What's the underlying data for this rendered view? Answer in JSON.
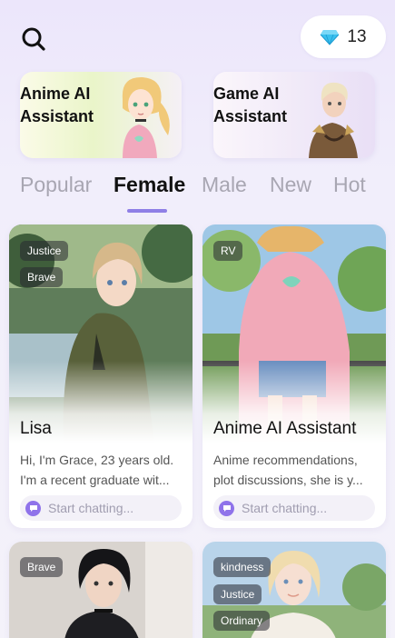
{
  "header": {
    "search_icon": "search-icon",
    "gem_icon": "diamond-icon",
    "gem_count": "13"
  },
  "promos": [
    {
      "title": "Anime AI Assistant"
    },
    {
      "title": "Game AI Assistant"
    }
  ],
  "tabs": [
    {
      "label": "Popular",
      "active": false
    },
    {
      "label": "Female",
      "active": true
    },
    {
      "label": "Male",
      "active": false
    },
    {
      "label": "New",
      "active": false
    },
    {
      "label": "Hot",
      "active": false
    }
  ],
  "cards": [
    {
      "badges": [
        "Justice",
        "Brave"
      ],
      "name": "Lisa",
      "desc_line1": "Hi, I'm Grace, 23 years old.",
      "desc_line2": "I'm a recent graduate wit...",
      "chat_label": "Start chatting..."
    },
    {
      "badges": [
        "RV"
      ],
      "name": "Anime AI Assistant",
      "desc_line1": "Anime recommendations,",
      "desc_line2": "plot discussions, she is y...",
      "chat_label": "Start chatting..."
    },
    {
      "badges": [
        "Brave"
      ]
    },
    {
      "badges": [
        "kindness",
        "Justice",
        "Ordinary"
      ]
    }
  ],
  "colors": {
    "accent": "#8f7fe6",
    "gem": "#39c0ee"
  }
}
